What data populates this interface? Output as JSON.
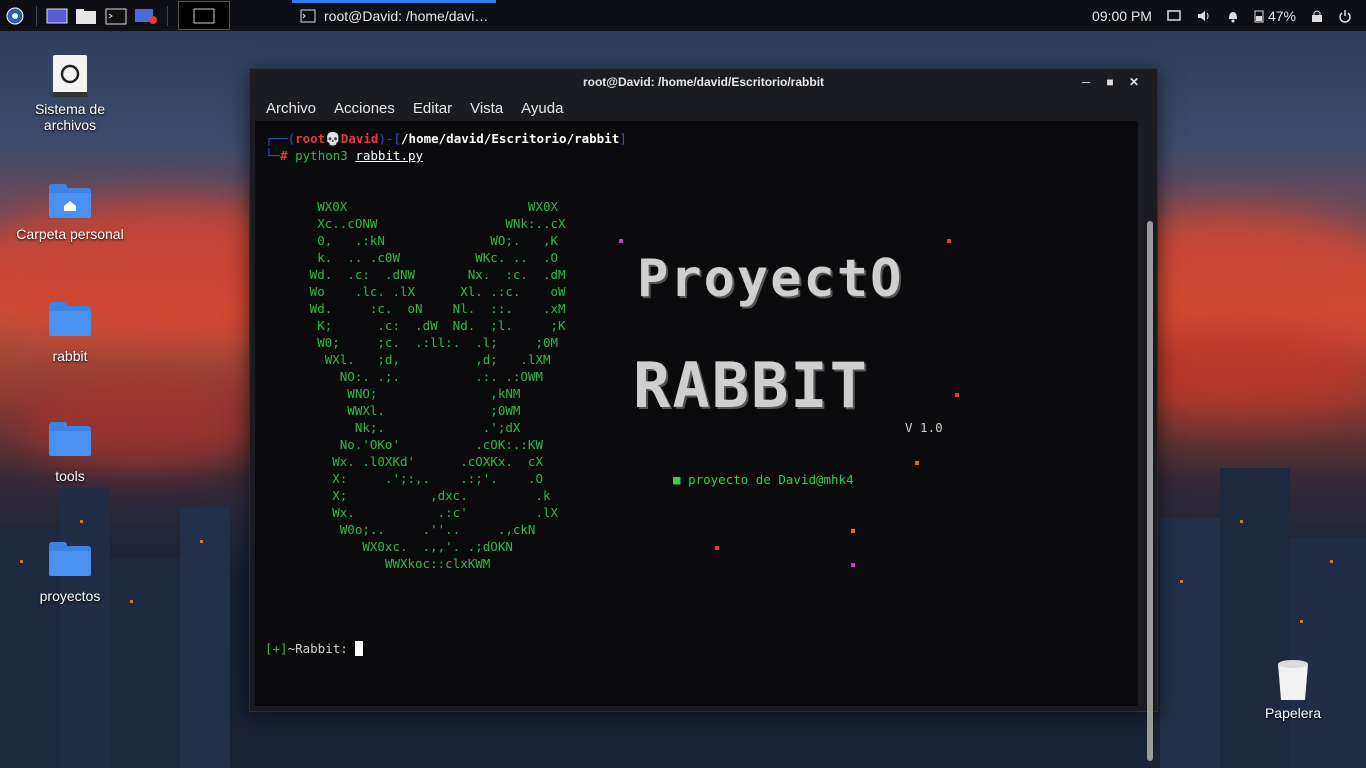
{
  "taskbar": {
    "window_title": "root@David: /home/davi…",
    "time": "09:00 PM",
    "battery": "47%"
  },
  "desktop": {
    "icons": [
      {
        "label": "Sistema de archivos"
      },
      {
        "label": "Carpeta personal"
      },
      {
        "label": "rabbit"
      },
      {
        "label": "tools"
      },
      {
        "label": "proyectos"
      }
    ],
    "trash_label": "Papelera"
  },
  "window": {
    "title": "root@David: /home/david/Escritorio/rabbit",
    "menu": [
      "Archivo",
      "Acciones",
      "Editar",
      "Vista",
      "Ayuda"
    ]
  },
  "terminal": {
    "prompt_user": "root",
    "prompt_skull": "💀",
    "prompt_host": "David",
    "prompt_path": "/home/david/Escritorio/rabbit",
    "prompt_hash": "#",
    "command": "python3",
    "command_arg": "rabbit.py",
    "ascii_art": "        WX0X                        WX0X\n        Xc..cONW                 WNk:..cX\n        0,   .:kN              WO;.   ,K\n        k.  .. .c0W          WKc. ..  .O\n       Wd.  .c:  .dNW       Nx.  :c.  .dM\n       Wo    .lc. .lX      Xl. .:c.    oW\n       Wd.     :c.  oN    Nl.  ::.    .xM\n        K;      .c:  .dW  Nd.  ;l.     ;K\n        W0;     ;c.  .:ll:.  .l;     ;0M\n         WXl.   ;d,          ,d;   .lXM\n           NO:. .;.          .:. .:OWM\n            WNO;               ,kNM\n            WWXl.              ;0WM\n             Nk;.             .';dX\n           No.'OKo'          .cOK:.:KW\n          Wx. .l0XKd'      .cOXKx.  cX\n          X:     .';:,.    .:;'.    .O\n          X;           ,dxc.         .k\n          Wx.           .:c'         .lX\n           W0o;..     .''..     .,ckN\n              WX0xc.  .,,'. .;dOKN\n                 WWXkoc::clxKWM",
    "banner_line1": "ProyectO",
    "banner_line2": "RABBIT",
    "version": "V 1.0",
    "credit": "proyecto de David@mhk4",
    "input_prefix": "[+]",
    "input_prompt": "~Rabbit:"
  },
  "colors": {
    "accent": "#367bf0",
    "prompt_blue": "#3b4bd8",
    "prompt_red": "#e23c3c",
    "ascii_green": "#2fb84a",
    "credit_green": "#33cc55"
  }
}
